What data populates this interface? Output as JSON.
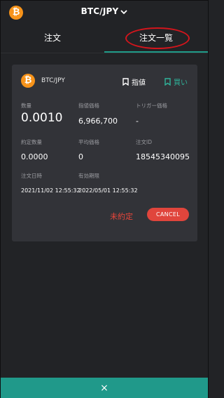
{
  "header": {
    "coin_symbol": "₿",
    "pair": "BTC/JPY"
  },
  "tabs": {
    "order": "注文",
    "order_list": "注文一覧"
  },
  "order": {
    "coin_symbol": "₿",
    "pair": "BTC/JPY",
    "type_label": "指値",
    "side_label": "買い",
    "fields": {
      "quantity_label": "数量",
      "quantity_value": "0.0010",
      "limit_price_label": "指値価格",
      "limit_price_value": "6,966,700",
      "trigger_price_label": "トリガー価格",
      "trigger_price_value": "-",
      "filled_qty_label": "約定数量",
      "filled_qty_value": "0.0000",
      "avg_price_label": "平均価格",
      "avg_price_value": "0",
      "order_id_label": "注文ID",
      "order_id_value": "18545340095",
      "order_time_label": "注文日時",
      "order_time_value": "2021/11/02 12:55:32",
      "expiry_label": "有効期限",
      "expiry_value": "2022/05/01 12:55:32"
    },
    "status": "未約定",
    "cancel_label": "CANCEL"
  },
  "bottom_bar": {
    "close_symbol": "×"
  },
  "colors": {
    "accent": "#20998a",
    "bitcoin": "#f7931a",
    "danger": "#e0453c",
    "annotation_circle": "#d2151c"
  }
}
